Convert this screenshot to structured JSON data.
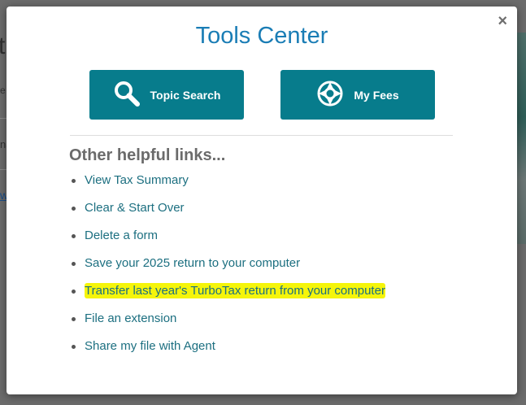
{
  "background": {
    "fragments": [
      "t",
      "e",
      "na",
      "w"
    ]
  },
  "modal": {
    "title": "Tools Center",
    "close_symbol": "×",
    "buttons": [
      {
        "label": "Topic Search",
        "icon": "search-icon"
      },
      {
        "label": "My Fees",
        "icon": "lifebuoy-icon"
      }
    ],
    "links_heading": "Other helpful links...",
    "links": [
      "View Tax Summary",
      "Clear & Start Over",
      "Delete a form",
      "Save your 2025 return to your computer",
      "Transfer last year's TurboTax return from your computer",
      "File an extension",
      "Share my file with Agent"
    ],
    "highlight_color": "#f5f50a",
    "accent_color": "#077c8c",
    "title_color": "#1a7db5"
  }
}
